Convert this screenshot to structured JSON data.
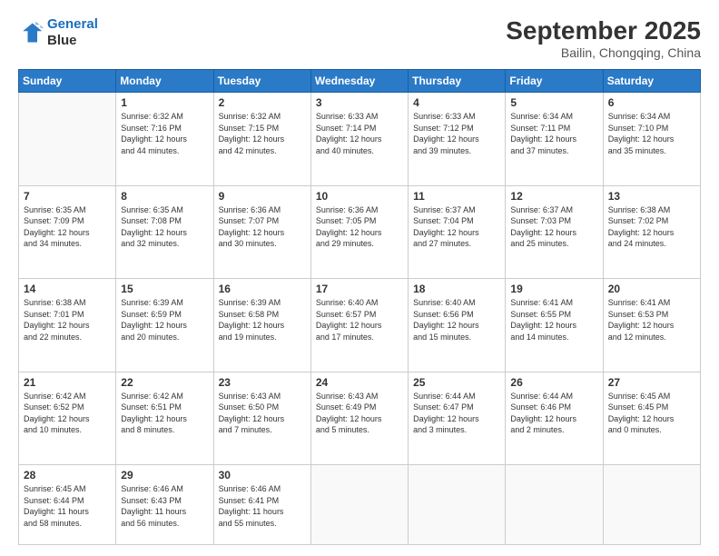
{
  "logo": {
    "line1": "General",
    "line2": "Blue"
  },
  "title": "September 2025",
  "subtitle": "Bailin, Chongqing, China",
  "weekdays": [
    "Sunday",
    "Monday",
    "Tuesday",
    "Wednesday",
    "Thursday",
    "Friday",
    "Saturday"
  ],
  "weeks": [
    [
      {
        "day": "",
        "info": ""
      },
      {
        "day": "1",
        "info": "Sunrise: 6:32 AM\nSunset: 7:16 PM\nDaylight: 12 hours\nand 44 minutes."
      },
      {
        "day": "2",
        "info": "Sunrise: 6:32 AM\nSunset: 7:15 PM\nDaylight: 12 hours\nand 42 minutes."
      },
      {
        "day": "3",
        "info": "Sunrise: 6:33 AM\nSunset: 7:14 PM\nDaylight: 12 hours\nand 40 minutes."
      },
      {
        "day": "4",
        "info": "Sunrise: 6:33 AM\nSunset: 7:12 PM\nDaylight: 12 hours\nand 39 minutes."
      },
      {
        "day": "5",
        "info": "Sunrise: 6:34 AM\nSunset: 7:11 PM\nDaylight: 12 hours\nand 37 minutes."
      },
      {
        "day": "6",
        "info": "Sunrise: 6:34 AM\nSunset: 7:10 PM\nDaylight: 12 hours\nand 35 minutes."
      }
    ],
    [
      {
        "day": "7",
        "info": "Sunrise: 6:35 AM\nSunset: 7:09 PM\nDaylight: 12 hours\nand 34 minutes."
      },
      {
        "day": "8",
        "info": "Sunrise: 6:35 AM\nSunset: 7:08 PM\nDaylight: 12 hours\nand 32 minutes."
      },
      {
        "day": "9",
        "info": "Sunrise: 6:36 AM\nSunset: 7:07 PM\nDaylight: 12 hours\nand 30 minutes."
      },
      {
        "day": "10",
        "info": "Sunrise: 6:36 AM\nSunset: 7:05 PM\nDaylight: 12 hours\nand 29 minutes."
      },
      {
        "day": "11",
        "info": "Sunrise: 6:37 AM\nSunset: 7:04 PM\nDaylight: 12 hours\nand 27 minutes."
      },
      {
        "day": "12",
        "info": "Sunrise: 6:37 AM\nSunset: 7:03 PM\nDaylight: 12 hours\nand 25 minutes."
      },
      {
        "day": "13",
        "info": "Sunrise: 6:38 AM\nSunset: 7:02 PM\nDaylight: 12 hours\nand 24 minutes."
      }
    ],
    [
      {
        "day": "14",
        "info": "Sunrise: 6:38 AM\nSunset: 7:01 PM\nDaylight: 12 hours\nand 22 minutes."
      },
      {
        "day": "15",
        "info": "Sunrise: 6:39 AM\nSunset: 6:59 PM\nDaylight: 12 hours\nand 20 minutes."
      },
      {
        "day": "16",
        "info": "Sunrise: 6:39 AM\nSunset: 6:58 PM\nDaylight: 12 hours\nand 19 minutes."
      },
      {
        "day": "17",
        "info": "Sunrise: 6:40 AM\nSunset: 6:57 PM\nDaylight: 12 hours\nand 17 minutes."
      },
      {
        "day": "18",
        "info": "Sunrise: 6:40 AM\nSunset: 6:56 PM\nDaylight: 12 hours\nand 15 minutes."
      },
      {
        "day": "19",
        "info": "Sunrise: 6:41 AM\nSunset: 6:55 PM\nDaylight: 12 hours\nand 14 minutes."
      },
      {
        "day": "20",
        "info": "Sunrise: 6:41 AM\nSunset: 6:53 PM\nDaylight: 12 hours\nand 12 minutes."
      }
    ],
    [
      {
        "day": "21",
        "info": "Sunrise: 6:42 AM\nSunset: 6:52 PM\nDaylight: 12 hours\nand 10 minutes."
      },
      {
        "day": "22",
        "info": "Sunrise: 6:42 AM\nSunset: 6:51 PM\nDaylight: 12 hours\nand 8 minutes."
      },
      {
        "day": "23",
        "info": "Sunrise: 6:43 AM\nSunset: 6:50 PM\nDaylight: 12 hours\nand 7 minutes."
      },
      {
        "day": "24",
        "info": "Sunrise: 6:43 AM\nSunset: 6:49 PM\nDaylight: 12 hours\nand 5 minutes."
      },
      {
        "day": "25",
        "info": "Sunrise: 6:44 AM\nSunset: 6:47 PM\nDaylight: 12 hours\nand 3 minutes."
      },
      {
        "day": "26",
        "info": "Sunrise: 6:44 AM\nSunset: 6:46 PM\nDaylight: 12 hours\nand 2 minutes."
      },
      {
        "day": "27",
        "info": "Sunrise: 6:45 AM\nSunset: 6:45 PM\nDaylight: 12 hours\nand 0 minutes."
      }
    ],
    [
      {
        "day": "28",
        "info": "Sunrise: 6:45 AM\nSunset: 6:44 PM\nDaylight: 11 hours\nand 58 minutes."
      },
      {
        "day": "29",
        "info": "Sunrise: 6:46 AM\nSunset: 6:43 PM\nDaylight: 11 hours\nand 56 minutes."
      },
      {
        "day": "30",
        "info": "Sunrise: 6:46 AM\nSunset: 6:41 PM\nDaylight: 11 hours\nand 55 minutes."
      },
      {
        "day": "",
        "info": ""
      },
      {
        "day": "",
        "info": ""
      },
      {
        "day": "",
        "info": ""
      },
      {
        "day": "",
        "info": ""
      }
    ]
  ]
}
